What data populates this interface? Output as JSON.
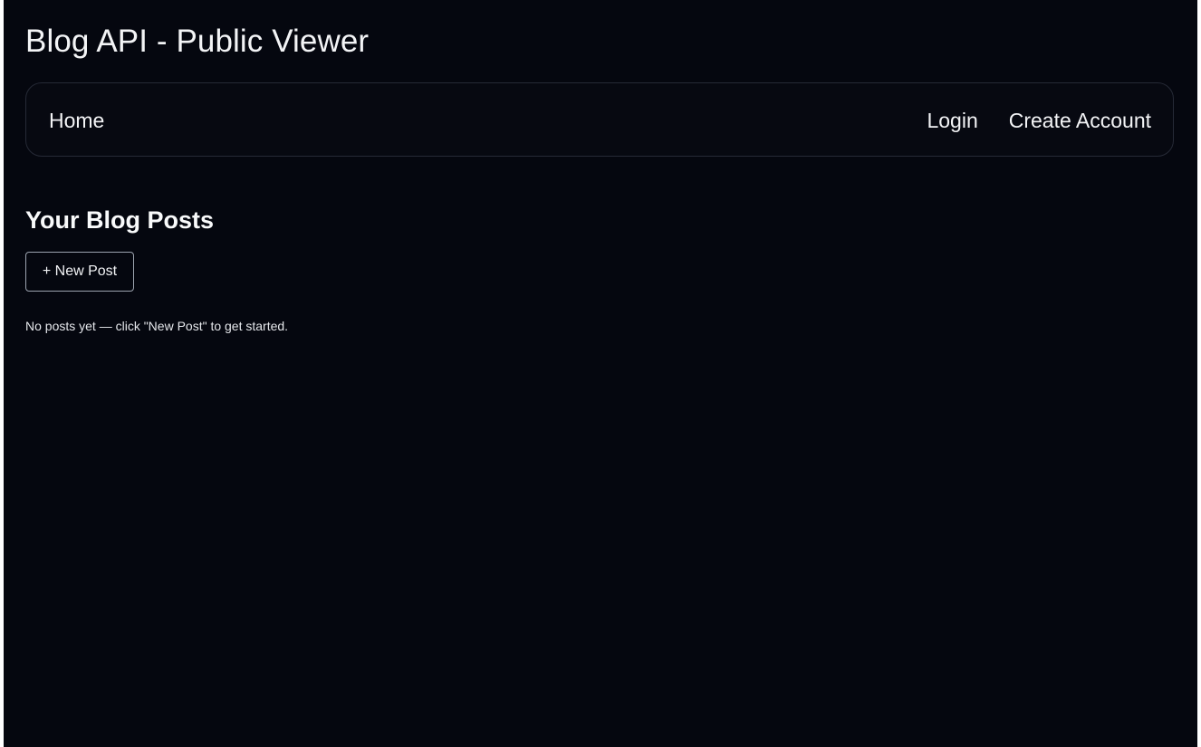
{
  "header": {
    "title": "Blog API - Public Viewer"
  },
  "nav": {
    "home_label": "Home",
    "login_label": "Login",
    "create_account_label": "Create Account"
  },
  "main": {
    "heading": "Your Blog Posts",
    "new_post_label": "+ New Post",
    "empty_message": "No posts yet — click \"New Post\" to get started."
  },
  "colors": {
    "background": "#05070f",
    "text": "#f3f4f6",
    "nav_border": "#262a36",
    "button_border": "#9ca3af"
  }
}
